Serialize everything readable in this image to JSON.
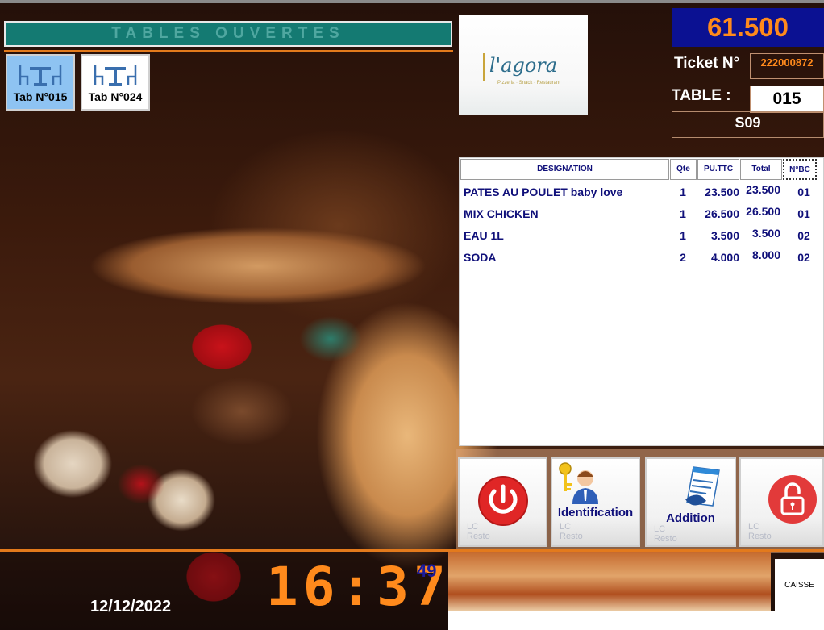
{
  "header": {
    "title": "TABLES OUVERTES"
  },
  "open_tables": [
    {
      "label": "Tab N°015",
      "active": true
    },
    {
      "label": "Tab N°024",
      "active": false
    }
  ],
  "logo": {
    "name": "l'agora",
    "tagline": "Pizzeria · Snack · Restaurant"
  },
  "ticket": {
    "total": "61.500",
    "ticket_label": "Ticket N°",
    "ticket_number": "222000872",
    "table_label": "TABLE :",
    "table_number": "015",
    "server": "S09"
  },
  "order": {
    "columns": [
      "DESIGNATION",
      "Qte",
      "PU.TTC",
      "Total",
      "N°BC"
    ],
    "rows": [
      {
        "designation": "PATES AU POULET baby love",
        "qte": "1",
        "pu": "23.500",
        "total": "23.500",
        "bc": "01"
      },
      {
        "designation": "MIX CHICKEN",
        "qte": "1",
        "pu": "26.500",
        "total": "26.500",
        "bc": "01"
      },
      {
        "designation": "EAU 1L",
        "qte": "1",
        "pu": "3.500",
        "total": "3.500",
        "bc": "02"
      },
      {
        "designation": "SODA",
        "qte": "2",
        "pu": "4.000",
        "total": "8.000",
        "bc": "02"
      }
    ]
  },
  "actions": {
    "power": {
      "watermark_top": "LC",
      "watermark_bottom": "Resto",
      "icon": "power-icon"
    },
    "identification": {
      "label": "Identification",
      "watermark_top": "LC",
      "watermark_bottom": "Resto",
      "icon": "user-key-icon"
    },
    "addition": {
      "label": "Addition",
      "watermark_top": "LC",
      "watermark_bottom": "Resto",
      "icon": "invoice-icon"
    },
    "unlock": {
      "watermark_top": "LC",
      "watermark_bottom": "Resto",
      "icon": "unlock-icon"
    }
  },
  "footer": {
    "date": "12/12/2022",
    "time": "16:37",
    "seconds": "49",
    "register": "CAISSE"
  },
  "colors": {
    "accent_orange": "#ff8a1c",
    "header_teal": "#147a72",
    "total_bg": "#0b1192",
    "text_navy": "#10107a"
  }
}
